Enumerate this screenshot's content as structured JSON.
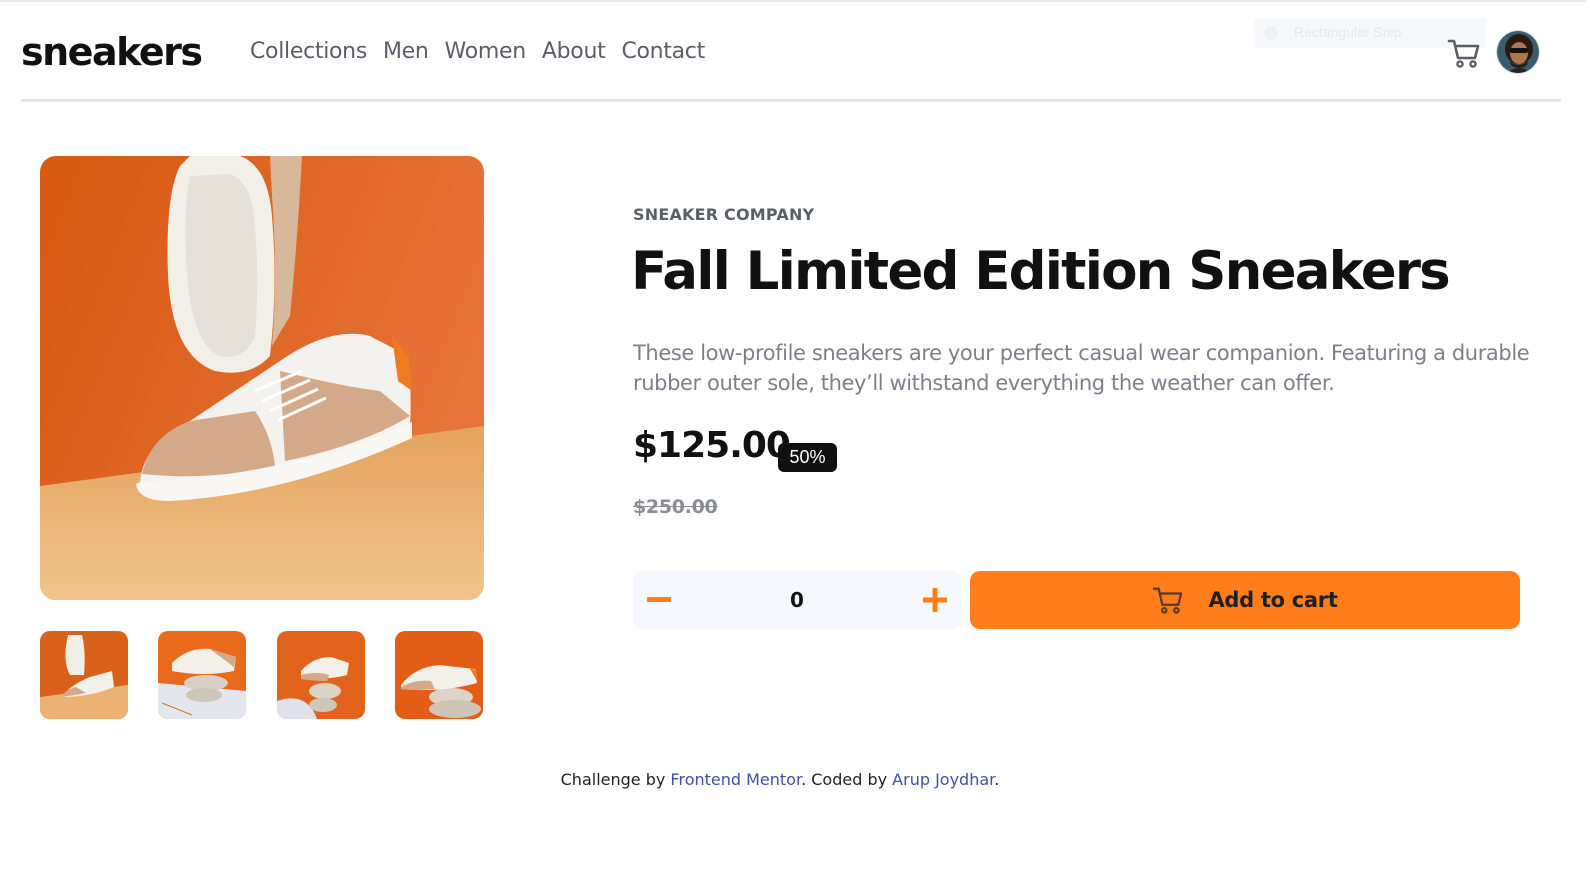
{
  "header": {
    "logo": "sneakers",
    "nav": [
      "Collections",
      "Men",
      "Women",
      "About",
      "Contact"
    ],
    "snip_overlay_label": "Rectangular Snip"
  },
  "product": {
    "company": "SNEAKER COMPANY",
    "title": "Fall Limited Edition Sneakers",
    "description": "These low-profile sneakers are your perfect casual wear companion. Featuring a durable rubber outer sole, they’ll withstand everything the weather can offer.",
    "price": "$125.00",
    "discount": "50%",
    "original_price": "$250.00",
    "quantity": "0",
    "add_to_cart": "Add to cart"
  },
  "gallery": {
    "thumbnails": [
      "product-1",
      "product-2",
      "product-3",
      "product-4"
    ]
  },
  "footer": {
    "prefix": "Challenge by ",
    "link1": "Frontend Mentor",
    "middle": ". Coded by ",
    "link2": "Arup Joydhar",
    "suffix": "."
  },
  "colors": {
    "accent": "#ff7e1b",
    "dark": "#1d2026",
    "muted": "#7c808a",
    "link": "#3e52a3"
  },
  "icons": [
    "cart-icon",
    "avatar",
    "minus-icon",
    "plus-icon"
  ]
}
